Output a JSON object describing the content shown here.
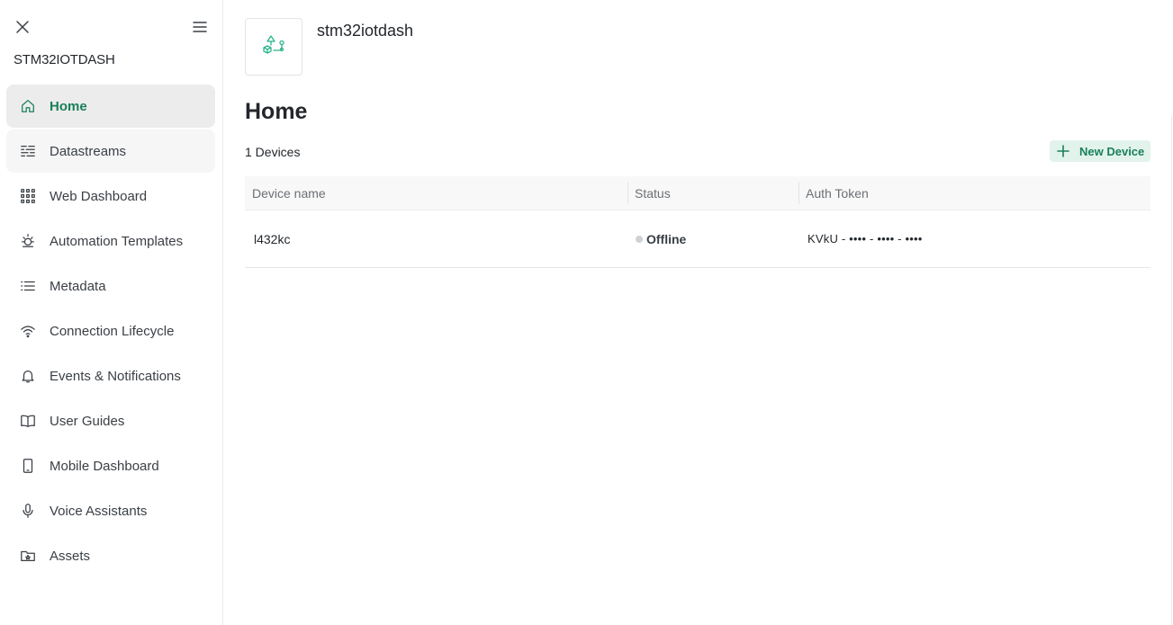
{
  "sidebar": {
    "title": "STM32IOTDASH",
    "close_icon": "close-icon",
    "menu_icon": "hamburger-menu-icon",
    "items": [
      {
        "label": "Home",
        "icon": "home-icon",
        "active": true
      },
      {
        "label": "Datastreams",
        "icon": "datastreams-icon"
      },
      {
        "label": "Web Dashboard",
        "icon": "grid-icon"
      },
      {
        "label": "Automation Templates",
        "icon": "automation-icon"
      },
      {
        "label": "Metadata",
        "icon": "list-icon"
      },
      {
        "label": "Connection Lifecycle",
        "icon": "wifi-icon"
      },
      {
        "label": "Events & Notifications",
        "icon": "bell-icon"
      },
      {
        "label": "User Guides",
        "icon": "book-icon"
      },
      {
        "label": "Mobile Dashboard",
        "icon": "mobile-icon"
      },
      {
        "label": "Voice Assistants",
        "icon": "microphone-icon"
      },
      {
        "label": "Assets",
        "icon": "folder-icon"
      }
    ]
  },
  "header": {
    "product_name": "stm32iotdash",
    "product_icon": "product-icon"
  },
  "main": {
    "title": "Home",
    "devices_count": "1 Devices",
    "new_device_label": "New Device",
    "table": {
      "headers": [
        "Device name",
        "Status",
        "Auth Token"
      ],
      "rows": [
        {
          "name": "l432kc",
          "status": "Offline",
          "token": "KVkU - •••• - •••• - ••••"
        }
      ]
    }
  },
  "colors": {
    "accent": "#1a7f5a",
    "accent_bg": "#e2f3ec",
    "active_nav_bg": "#ececec",
    "offline_dot": "#cfd2d5"
  }
}
